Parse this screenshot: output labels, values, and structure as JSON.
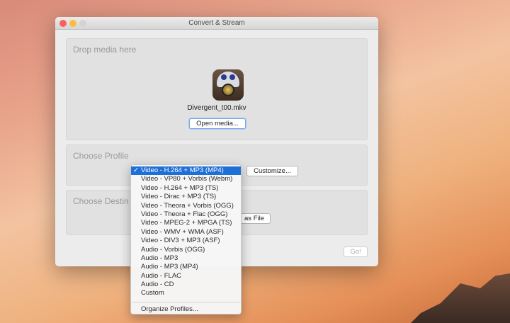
{
  "window": {
    "title": "Convert & Stream"
  },
  "drop": {
    "label": "Drop media here",
    "file_name": "Divergent_t00.mkv",
    "open_button": "Open media..."
  },
  "profile": {
    "label": "Choose Profile",
    "customize_button": "Customize..."
  },
  "destination": {
    "label": "Choose Destin",
    "save_button": "as File"
  },
  "go_button": "Go!",
  "menu": {
    "check": "✓",
    "items": [
      "Video - H.264 + MP3 (MP4)",
      "Video - VP80 + Vorbis (Webm)",
      "Video - H.264 + MP3 (TS)",
      "Video - Dirac + MP3 (TS)",
      "Video - Theora + Vorbis (OGG)",
      "Video - Theora + Flac (OGG)",
      "Video - MPEG-2 + MPGA (TS)",
      "Video - WMV + WMA (ASF)",
      "Video - DIV3 + MP3 (ASF)",
      "Audio - Vorbis (OGG)",
      "Audio - MP3",
      "Audio - MP3 (MP4)",
      "Audio - FLAC",
      "Audio - CD",
      "Custom"
    ],
    "organize": "Organize Profiles..."
  }
}
